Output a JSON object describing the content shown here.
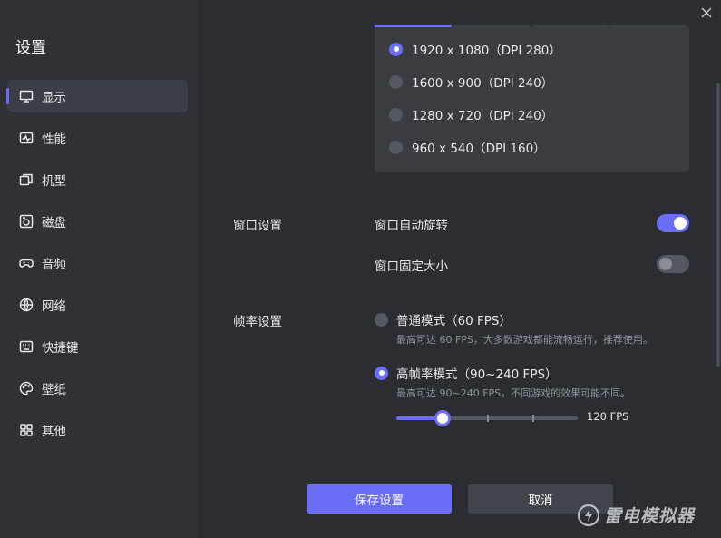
{
  "sidebar": {
    "title": "设置",
    "items": [
      {
        "label": "显示",
        "icon": "monitor-icon",
        "active": true
      },
      {
        "label": "性能",
        "icon": "performance-icon"
      },
      {
        "label": "机型",
        "icon": "device-model-icon"
      },
      {
        "label": "磁盘",
        "icon": "disk-icon"
      },
      {
        "label": "音频",
        "icon": "gamepad-icon"
      },
      {
        "label": "网络",
        "icon": "globe-icon"
      },
      {
        "label": "快捷键",
        "icon": "keyboard-icon"
      },
      {
        "label": "壁纸",
        "icon": "palette-icon"
      },
      {
        "label": "其他",
        "icon": "grid-icon"
      }
    ]
  },
  "resolution": {
    "options": [
      {
        "label": "1920 x 1080（DPI 280）",
        "selected": true
      },
      {
        "label": "1600 x 900（DPI 240）",
        "selected": false
      },
      {
        "label": "1280 x 720（DPI 240）",
        "selected": false
      },
      {
        "label": "960 x 540（DPI 160）",
        "selected": false
      }
    ]
  },
  "window": {
    "section_label": "窗口设置",
    "auto_rotate_label": "窗口自动旋转",
    "auto_rotate_on": true,
    "fixed_size_label": "窗口固定大小",
    "fixed_size_on": false
  },
  "framerate": {
    "section_label": "帧率设置",
    "normal_title": "普通模式（60 FPS）",
    "normal_desc": "最高可达 60 FPS，大多数游戏都能流畅运行，推荐使用。",
    "normal_selected": false,
    "high_title": "高帧率模式（90~240 FPS）",
    "high_desc": "最高可达 90~240 FPS，不同游戏的效果可能不同。",
    "high_selected": true,
    "slider_value": "120 FPS",
    "slider_min_fps": 90,
    "slider_max_fps": 240,
    "slider_current_fps": 120
  },
  "footer": {
    "save_label": "保存设置",
    "cancel_label": "取消",
    "brand": "雷电模拟器"
  },
  "colors": {
    "accent": "#6a6df5",
    "sidebar_bg": "#2f3136",
    "main_bg": "#2b2d33",
    "panel_bg": "#3a3c42"
  }
}
